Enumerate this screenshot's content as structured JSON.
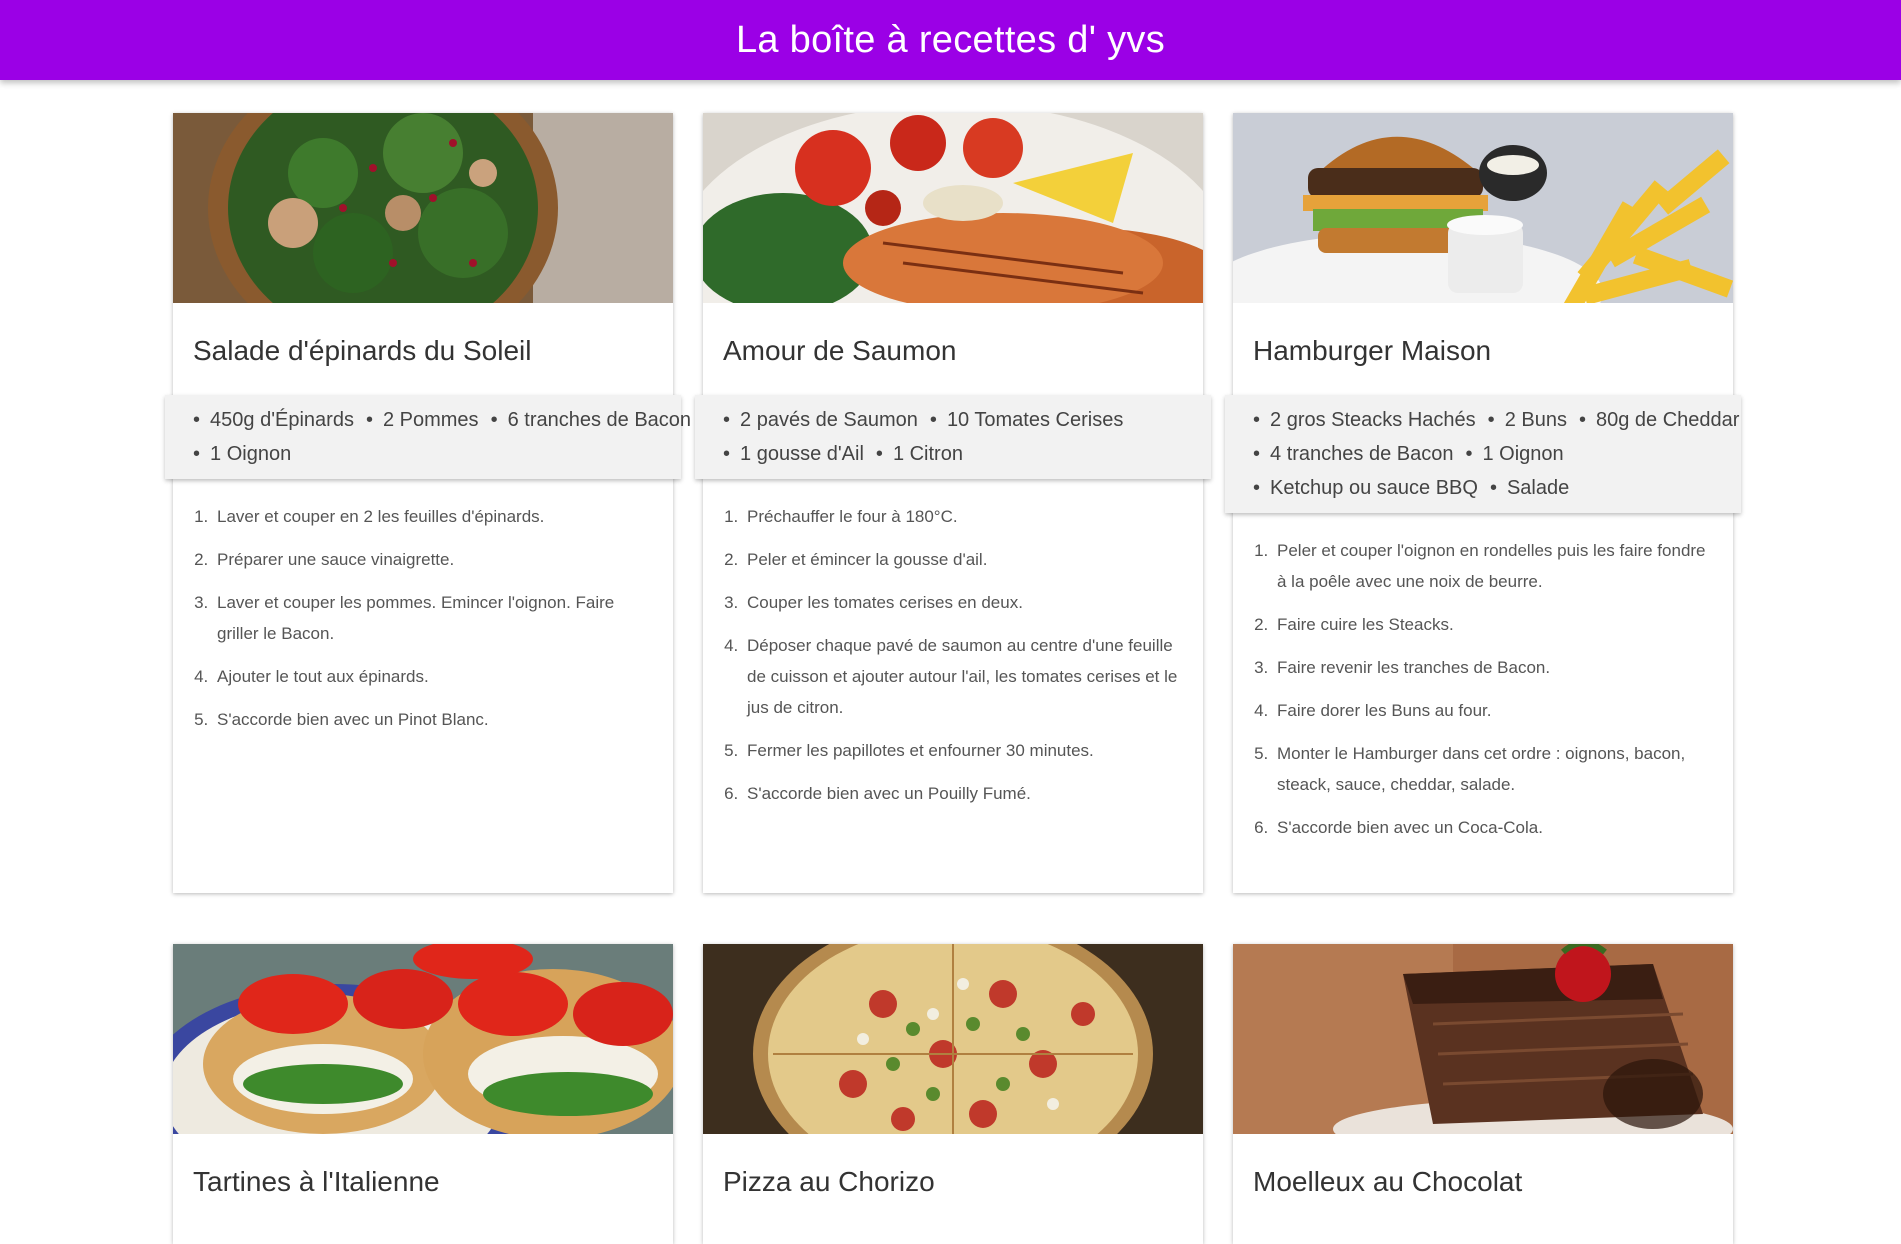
{
  "header": {
    "title": "La boîte à recettes d' yvs"
  },
  "recipes": [
    {
      "title": "Salade d'épinards du Soleil",
      "image_icon": "spinach-salad-photo",
      "ingredient_lines": [
        [
          "450g d'Épinards",
          "2 Pommes",
          "6 tranches de Bacon"
        ],
        [
          "1 Oignon"
        ]
      ],
      "steps": [
        "Laver et couper en 2 les feuilles d'épinards.",
        "Préparer une sauce vinaigrette.",
        "Laver et couper les pommes. Emincer l'oignon. Faire griller le Bacon.",
        "Ajouter le tout aux épinards.",
        "S'accorde bien avec un Pinot Blanc."
      ]
    },
    {
      "title": "Amour de Saumon",
      "image_icon": "salmon-dish-photo",
      "ingredient_lines": [
        [
          "2 pavés de Saumon",
          "10 Tomates Cerises"
        ],
        [
          "1 gousse d'Ail",
          "1 Citron"
        ]
      ],
      "steps": [
        "Préchauffer le four à 180°C.",
        "Peler et émincer la gousse d'ail.",
        "Couper les tomates cerises en deux.",
        "Déposer chaque pavé de saumon au centre d'une feuille de cuisson et ajouter autour l'ail, les tomates cerises et le jus de citron.",
        "Fermer les papillotes et enfourner 30 minutes.",
        "S'accorde bien avec un Pouilly Fumé."
      ]
    },
    {
      "title": "Hamburger Maison",
      "image_icon": "hamburger-photo",
      "ingredient_lines": [
        [
          "2 gros Steacks Hachés",
          "2 Buns",
          "80g de Cheddar"
        ],
        [
          "4 tranches de Bacon",
          "1 Oignon"
        ],
        [
          "Ketchup ou sauce BBQ",
          "Salade"
        ]
      ],
      "steps": [
        "Peler et couper l'oignon en rondelles puis les faire fondre à la poêle avec une noix de beurre.",
        "Faire cuire les Steacks.",
        "Faire revenir les tranches de Bacon.",
        "Faire dorer les Buns au four.",
        "Monter le Hamburger dans cet ordre : oignons, bacon, steack, sauce, cheddar, salade.",
        "S'accorde bien avec un Coca-Cola."
      ]
    },
    {
      "title": "Tartines à l'Italienne",
      "image_icon": "tartines-photo"
    },
    {
      "title": "Pizza au Chorizo",
      "image_icon": "pizza-photo"
    },
    {
      "title": "Moelleux au Chocolat",
      "image_icon": "chocolate-cake-photo"
    }
  ]
}
